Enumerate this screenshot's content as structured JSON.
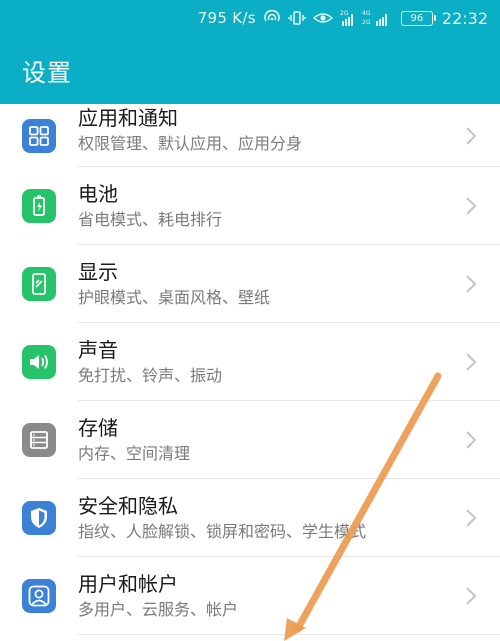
{
  "status_bar": {
    "network_speed": "795 K/s",
    "battery_level": "96",
    "time": "22:32",
    "network_labels": [
      "2G",
      "4G",
      "2G"
    ]
  },
  "app_bar": {
    "title": "设置"
  },
  "settings_list": [
    {
      "icon": "apps-icon",
      "title": "应用和通知",
      "subtitle": "权限管理、默认应用、应用分身",
      "icon_color": "#3b82d6"
    },
    {
      "icon": "battery-icon",
      "title": "电池",
      "subtitle": "省电模式、耗电排行",
      "icon_color": "#27c36b"
    },
    {
      "icon": "display-icon",
      "title": "显示",
      "subtitle": "护眼模式、桌面风格、壁纸",
      "icon_color": "#27c36b"
    },
    {
      "icon": "sound-icon",
      "title": "声音",
      "subtitle": "免打扰、铃声、振动",
      "icon_color": "#27c36b"
    },
    {
      "icon": "storage-icon",
      "title": "存储",
      "subtitle": "内存、空间清理",
      "icon_color": "#8a8a8a"
    },
    {
      "icon": "shield-icon",
      "title": "安全和隐私",
      "subtitle": "指纹、人脸解锁、锁屏和密码、学生模式",
      "icon_color": "#3b82d6"
    },
    {
      "icon": "user-icon",
      "title": "用户和帐户",
      "subtitle": "多用户、云服务、帐户",
      "icon_color": "#3b82d6"
    }
  ],
  "colors": {
    "accent": "#0aaec5",
    "annotation_arrow": "#ec9a50"
  }
}
